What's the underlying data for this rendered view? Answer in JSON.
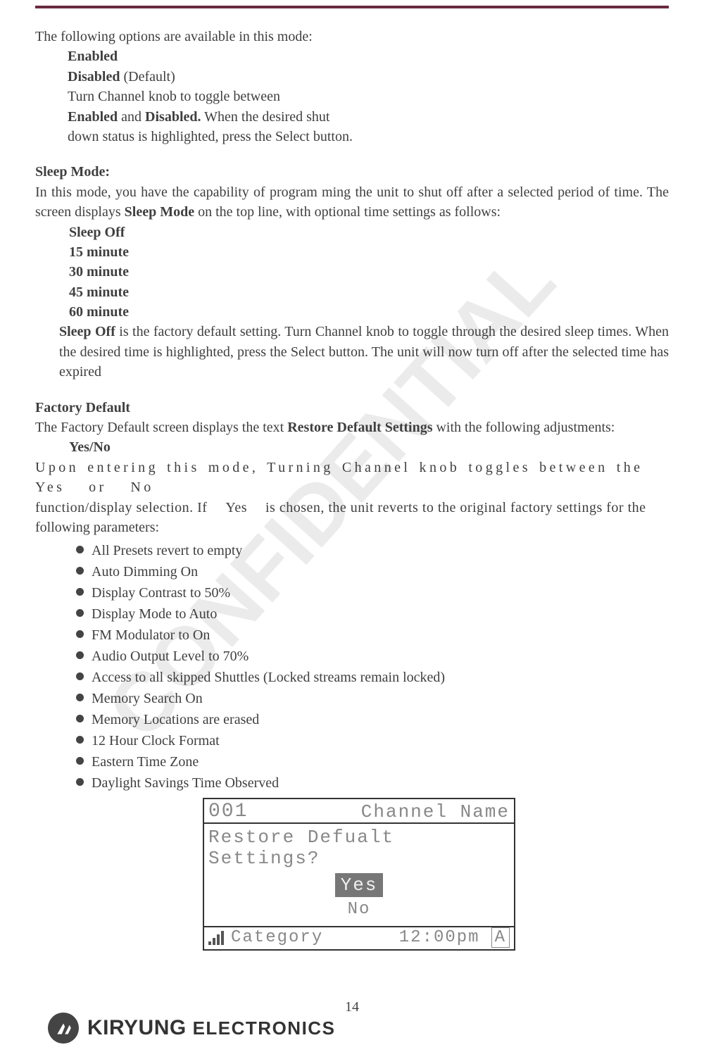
{
  "intro_line": "The following options are available in this mode:",
  "options": {
    "enabled": "Enabled",
    "disabled": "Disabled",
    "disabled_suffix": " (Default)",
    "turn_line": "Turn Channel knob to toggle between",
    "enabled2": "Enabled",
    "and_word": " and ",
    "disabled2": "Disabled.",
    "when_line": " When the desired shut",
    "down_line": "down status is highlighted, press the Select button."
  },
  "sleep": {
    "heading": "Sleep Mode:",
    "para": "In this mode, you have the capability of program ming the unit to shut off after a selected period of time. The screen displays ",
    "para_bold": "Sleep Mode",
    "para_tail": " on the top line, with optional time settings as follows:",
    "items": [
      "Sleep Off",
      "15 minute",
      "30 minute",
      "45 minute",
      "60 minute"
    ],
    "desc_b": "Sleep Off",
    "desc_tail": " is the factory default setting. Turn Channel knob to toggle through the desired sleep times. When the desired time is highlighted, press the Select button. The unit will now turn off after the selected time has expired"
  },
  "factory": {
    "heading": "Factory Default",
    "para1a": "The Factory Default screen displays the text ",
    "para1b": "Restore Default Settings",
    "para1c": " with the following adjustments:",
    "yesno": "Yes/No",
    "para2a": "Upon entering this mode, Turning Channel knob toggles between the  Yes  or  No ",
    "para2b": "function/display selection. If  Yes  is chosen, the unit reverts to the original factory settings for the",
    "para2c": "following parameters:",
    "bullets": [
      "All Presets revert to empty",
      "Auto Dimming On",
      "Display Contrast to 50%",
      "Display Mode to Auto",
      "FM Modulator to On",
      "Audio Output Level to 70%",
      "Access to all skipped Shuttles (Locked streams remain locked)",
      "Memory Search On",
      "Memory Locations are erased",
      "12 Hour Clock Format",
      "Eastern Time Zone",
      "Daylight Savings Time Observed"
    ]
  },
  "lcd": {
    "ch_num": "001",
    "ch_title": "Channel Name",
    "prompt": "Restore Defualt Settings?",
    "yes": "Yes",
    "no": "No",
    "category": "Category",
    "time": "12:00pm",
    "ant": "A"
  },
  "page_number": "14",
  "brand": {
    "name": "KIRYUNG",
    "suffix": "ELECTRONICS"
  },
  "watermark_text": "CONFIDENTIAL"
}
